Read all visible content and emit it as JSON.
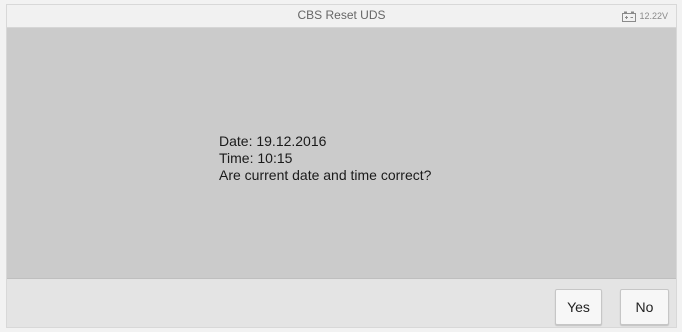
{
  "window": {
    "title": "CBS Reset UDS",
    "battery_voltage": "12.22V"
  },
  "message": {
    "date_line": "Date: 19.12.2016",
    "time_line": "Time: 10:15",
    "question": "Are current date and time correct?"
  },
  "footer": {
    "yes_label": "Yes",
    "no_label": "No"
  },
  "icons": {
    "battery": "battery-icon"
  }
}
